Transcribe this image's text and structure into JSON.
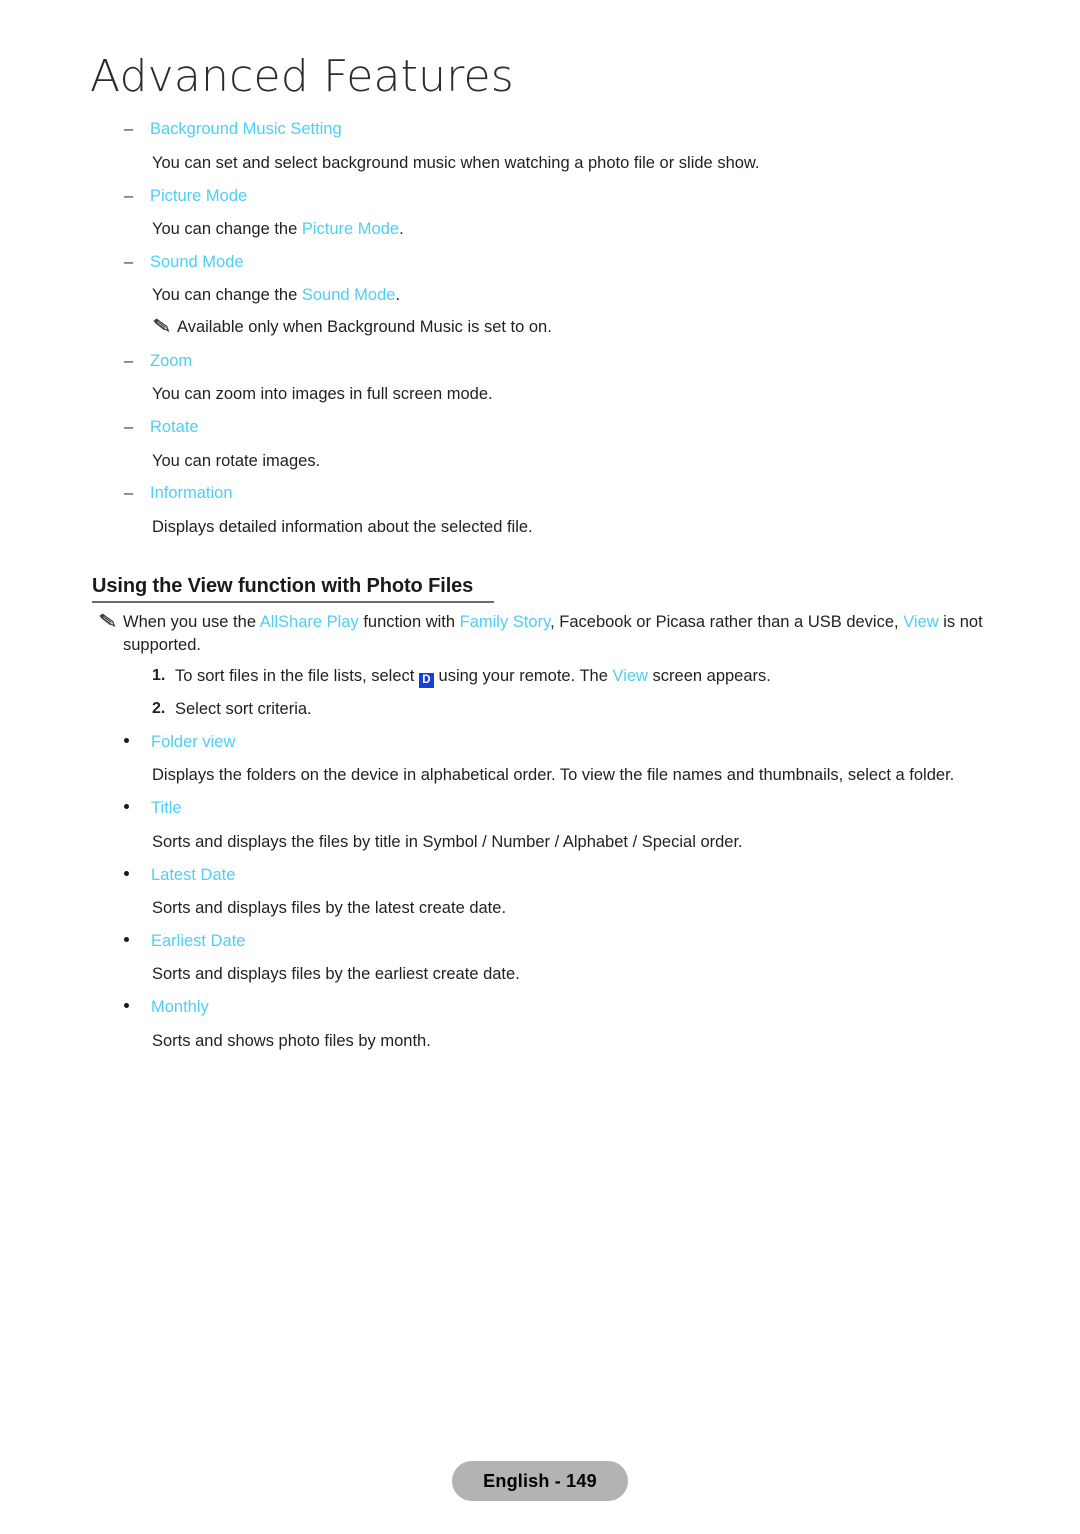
{
  "chapter": {
    "title": "Advanced Features"
  },
  "options": [
    {
      "label": "Background Music Setting",
      "desc_before": "You can set and select background music when watching a photo file or slide show.",
      "desc_term": "",
      "desc_after": ""
    },
    {
      "label": "Picture Mode",
      "desc_before": "You can change the ",
      "desc_term": "Picture Mode",
      "desc_after": "."
    },
    {
      "label": "Sound Mode",
      "desc_before": "You can change the ",
      "desc_term": "Sound Mode",
      "desc_after": "."
    },
    {
      "label": "Zoom",
      "desc_before": "You can zoom into images in full screen mode.",
      "desc_term": "",
      "desc_after": ""
    },
    {
      "label": "Rotate",
      "desc_before": "You can rotate images.",
      "desc_term": "",
      "desc_after": ""
    },
    {
      "label": "Information",
      "desc_before": "Displays detailed information about the selected file.",
      "desc_term": "",
      "desc_after": ""
    }
  ],
  "dash_mark": "–",
  "sound_note": "Available only when Background Music is set to on.",
  "section": {
    "heading": "Using the View function with Photo Files",
    "note": {
      "p1": "When you use the ",
      "t1": "AllShare Play",
      "p2": " function with ",
      "t2": "Family Story",
      "p3": ", Facebook or Picasa rather than a USB device, ",
      "t3": "View",
      "p4": " is not supported."
    },
    "steps": [
      {
        "num": "1.",
        "before": "To sort files in the file lists, select ",
        "key": "D",
        "middle": " using your remote. The ",
        "term": "View",
        "after": " screen appears."
      },
      {
        "num": "2.",
        "before": "Select sort criteria.",
        "key": "",
        "middle": "",
        "term": "",
        "after": ""
      }
    ],
    "sort_options": [
      {
        "label": "Folder view",
        "desc": "Displays the folders on the device in alphabetical order. To view the file names and thumbnails, select a folder."
      },
      {
        "label": "Title",
        "desc": "Sorts and displays the files by title in Symbol / Number / Alphabet / Special order."
      },
      {
        "label": "Latest Date",
        "desc": "Sorts and displays files by the latest create date."
      },
      {
        "label": "Earliest Date",
        "desc": "Sorts and displays files by the earliest create date."
      },
      {
        "label": "Monthly",
        "desc": "Sorts and shows photo files by month."
      }
    ]
  },
  "footer": {
    "label": "English - 149"
  },
  "colors": {
    "accent_cyan": "#4dcff5",
    "key_blue": "#1a3fd8",
    "footer_gray": "#b3b3b3",
    "text": "#231f20"
  }
}
